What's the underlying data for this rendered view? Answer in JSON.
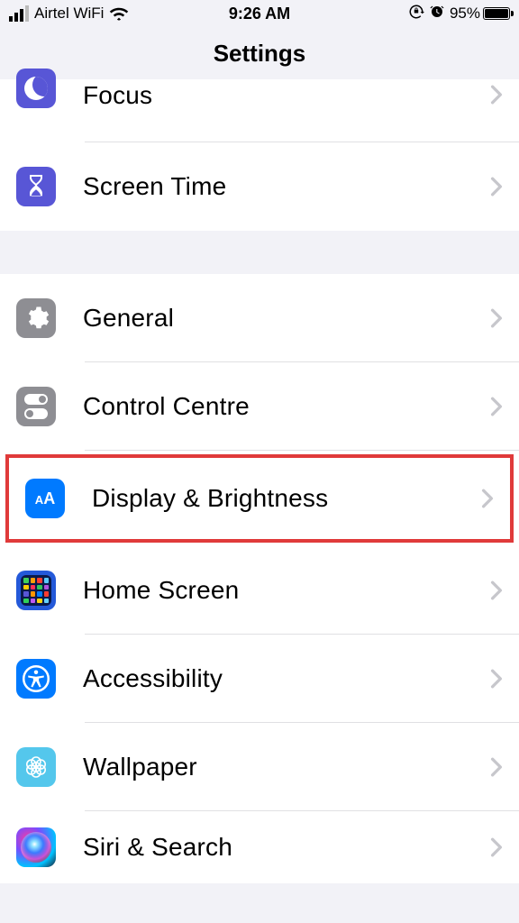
{
  "status": {
    "carrier": "Airtel WiFi",
    "time": "9:26 AM",
    "battery_pct": "95%"
  },
  "header": {
    "title": "Settings"
  },
  "section1": {
    "items": [
      {
        "label": "Focus"
      },
      {
        "label": "Screen Time"
      }
    ]
  },
  "section2": {
    "items": [
      {
        "label": "General"
      },
      {
        "label": "Control Centre"
      },
      {
        "label": "Display & Brightness"
      },
      {
        "label": "Home Screen"
      },
      {
        "label": "Accessibility"
      },
      {
        "label": "Wallpaper"
      },
      {
        "label": "Siri & Search"
      }
    ]
  }
}
